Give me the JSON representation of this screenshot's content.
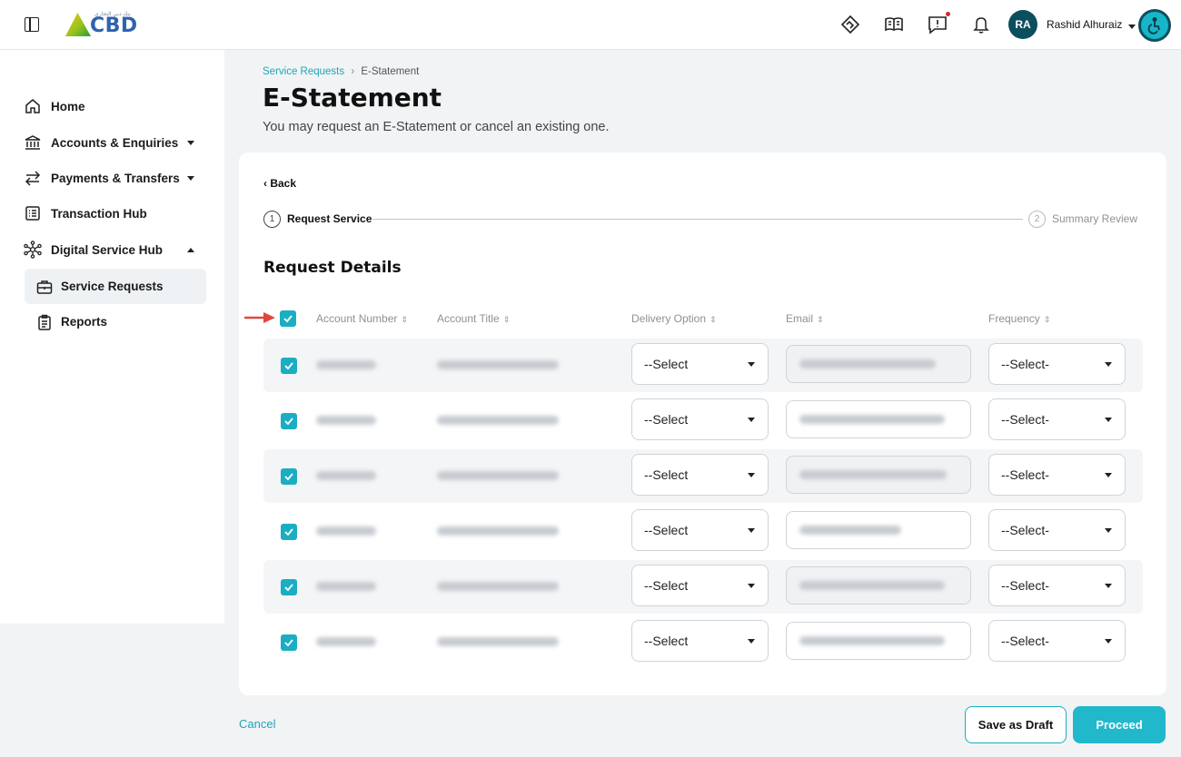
{
  "header": {
    "logo_text": "CBD",
    "logo_subtext": "بنك دبي التجاري",
    "user_initials": "RA",
    "user_name": "Rashid Alhuraiz"
  },
  "sidebar": {
    "items": [
      {
        "label": "Home",
        "icon": "home-icon"
      },
      {
        "label": "Accounts & Enquiries",
        "icon": "bank-icon"
      },
      {
        "label": "Payments & Transfers",
        "icon": "transfer-arrows-icon"
      },
      {
        "label": "Transaction Hub",
        "icon": "list-icon"
      },
      {
        "label": "Digital Service Hub",
        "icon": "network-icon"
      }
    ],
    "sub_items": [
      {
        "label": "Service Requests",
        "icon": "briefcase-icon"
      },
      {
        "label": "Reports",
        "icon": "clipboard-icon"
      }
    ]
  },
  "breadcrumb": {
    "parent": "Service Requests",
    "separator": "›",
    "current": "E-Statement"
  },
  "page": {
    "title": "E-Statement",
    "subtitle": "You may request an E-Statement or cancel an existing one."
  },
  "card": {
    "back_label": "‹ Back",
    "steps": [
      {
        "number": "1",
        "label": "Request Service"
      },
      {
        "number": "2",
        "label": "Summary Review"
      }
    ],
    "section_title": "Request Details",
    "columns": [
      "Account Number",
      "Account Title",
      "Delivery Option",
      "Email",
      "Frequency"
    ],
    "sort_glyph": "⇕",
    "rows": [
      {
        "delivery": "--Select",
        "frequency": "--Select-"
      },
      {
        "delivery": "--Select",
        "frequency": "--Select-"
      },
      {
        "delivery": "--Select",
        "frequency": "--Select-"
      },
      {
        "delivery": "--Select",
        "frequency": "--Select-"
      },
      {
        "delivery": "--Select",
        "frequency": "--Select-"
      },
      {
        "delivery": "--Select",
        "frequency": "--Select-"
      }
    ]
  },
  "footer": {
    "cancel_label": "Cancel",
    "draft_label": "Save as Draft",
    "proceed_label": "Proceed"
  },
  "colors": {
    "accent": "#1baec2",
    "link": "#1fa6b8",
    "avatar_bg": "#0d4e5e",
    "notification_dot": "#d22d2d",
    "annotation_arrow": "#e0473a"
  }
}
